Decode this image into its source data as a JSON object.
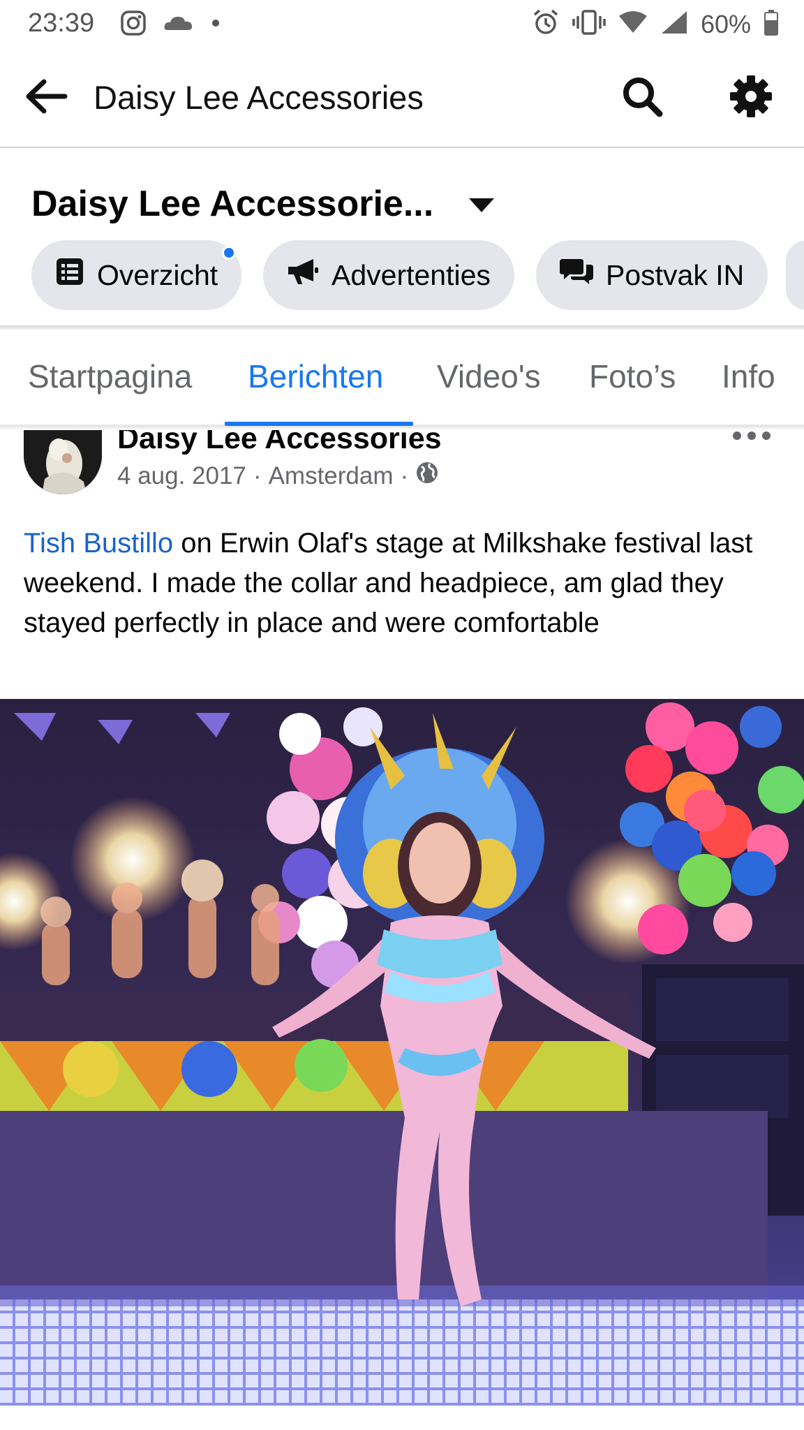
{
  "status_bar": {
    "time": "23:39",
    "battery": "60%",
    "icons": [
      "instagram-icon",
      "cloud-icon",
      "dot-icon",
      "alarm-icon",
      "vibrate-icon",
      "wifi-icon",
      "signal-icon",
      "battery-icon"
    ]
  },
  "app_bar": {
    "title": "Daisy Lee Accessories",
    "icons": [
      "back-arrow-icon",
      "search-icon",
      "gear-icon"
    ]
  },
  "page_header": {
    "name": "Daisy Lee Accessorie...",
    "chips": [
      {
        "label": "Overzicht",
        "icon": "list-icon",
        "has_notification_dot": true
      },
      {
        "label": "Advertenties",
        "icon": "megaphone-icon"
      },
      {
        "label": "Postvak IN",
        "icon": "chat-bubbles-icon"
      }
    ]
  },
  "tabs": {
    "items": [
      {
        "label": "Startpagina"
      },
      {
        "label": "Berichten",
        "active": true
      },
      {
        "label": "Video's"
      },
      {
        "label": "Foto’s"
      },
      {
        "label": "Info"
      }
    ]
  },
  "post": {
    "author": "Daisy Lee Accessories",
    "date": "4 aug. 2017",
    "separator": "·",
    "location": "Amsterdam",
    "privacy_icon": "globe-icon",
    "mention": "Tish Bustillo",
    "text": " on Erwin Olaf's stage at Milkshake festival last weekend. I made the collar and headpiece, am glad they stayed perfectly in place and were comfortable"
  },
  "colors": {
    "accent": "#1877f2",
    "chip_bg": "#e4e6eb",
    "secondary_text": "#65676b"
  }
}
